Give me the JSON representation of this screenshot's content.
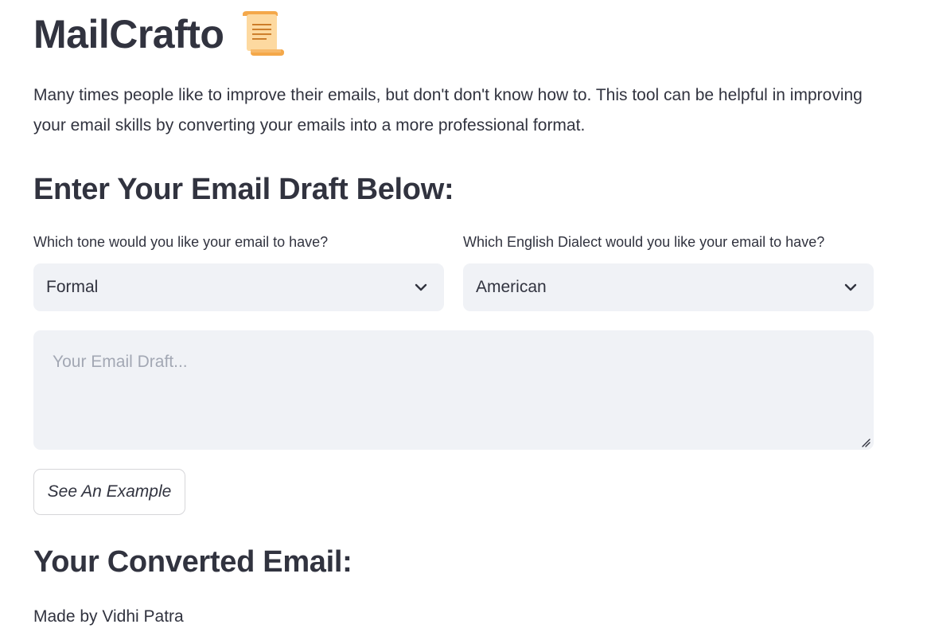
{
  "app": {
    "title": "MailCrafto",
    "title_icon": "scroll-icon"
  },
  "intro": {
    "text": "Many times people like to improve their emails, but don't don't know how to. This tool can be helpful in improving your email skills by converting your emails into a more professional format."
  },
  "form": {
    "heading": "Enter Your Email Draft Below:",
    "tone": {
      "label": "Which tone would you like your email to have?",
      "selected": "Formal"
    },
    "dialect": {
      "label": "Which English Dialect would you like your email to have?",
      "selected": "American"
    },
    "draft": {
      "value": "",
      "placeholder": "Your Email Draft..."
    },
    "example_button_label": "See An Example"
  },
  "output": {
    "heading": "Your Converted Email:"
  },
  "footer": {
    "credit": "Made by Vidhi Patra"
  },
  "colors": {
    "text": "#31333f",
    "input_background": "#f0f2f6",
    "placeholder": "#a3a8b4",
    "button_border": "#d6d6d9"
  }
}
